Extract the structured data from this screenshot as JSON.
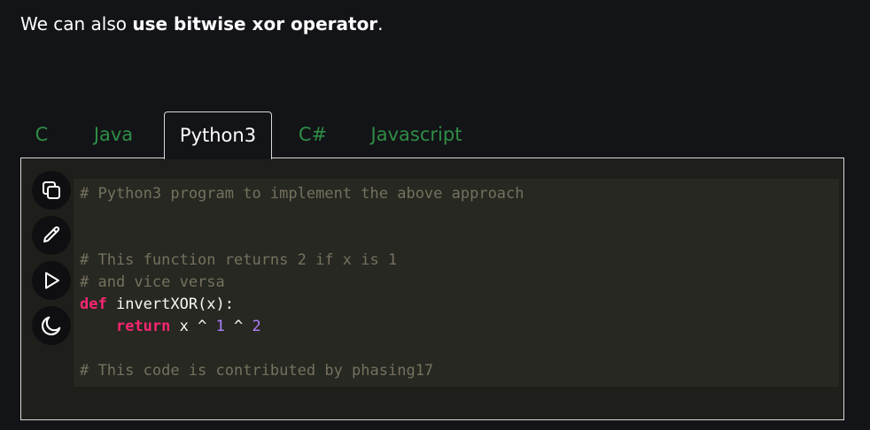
{
  "intro": {
    "prefix": "We can also ",
    "bold": "use bitwise xor operator",
    "suffix": "."
  },
  "tabs": [
    {
      "label": "C",
      "active": false
    },
    {
      "label": "Java",
      "active": false
    },
    {
      "label": "Python3",
      "active": true
    },
    {
      "label": "C#",
      "active": false
    },
    {
      "label": "Javascript",
      "active": false
    }
  ],
  "side_buttons": [
    {
      "icon": "copy-icon"
    },
    {
      "icon": "edit-pencil-icon"
    },
    {
      "icon": "run-play-icon"
    },
    {
      "icon": "dark-mode-moon-icon"
    }
  ],
  "code": {
    "line1": "# Python3 program to implement the above approach",
    "line4": "# This function returns 2 if x is 1",
    "line5": "# and vice versa",
    "line6_kw": "def",
    "line6_rest": " invertXOR(x):",
    "line7_indent": "    ",
    "line7_kw": "return",
    "line7_a": " x ^ ",
    "line7_n1": "1",
    "line7_b": " ^ ",
    "line7_n2": "2",
    "line9": "# This code is contributed by phasing17"
  },
  "colors": {
    "background": "#131417",
    "tab_inactive": "#2f8d46",
    "tab_active": "#ffffff",
    "code_bg": "#272822",
    "comment": "#75715e",
    "keyword": "#f92672",
    "number": "#ae81ff"
  }
}
